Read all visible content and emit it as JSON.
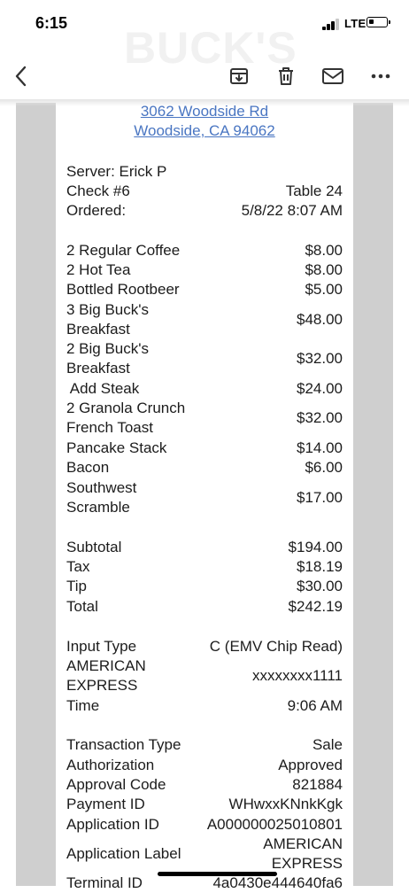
{
  "status_bar": {
    "time": "6:15",
    "network": "LTE"
  },
  "watermark": "BUCK'S",
  "toolbar": {
    "back_icon": "chevron-left-icon",
    "archive_icon": "archive-download-icon",
    "trash_icon": "trash-icon",
    "mail_icon": "envelope-icon",
    "more_icon": "more-horizontal-icon"
  },
  "receipt": {
    "address_line1": "3062 Woodside Rd",
    "address_line2": "Woodside, CA 94062",
    "server": "Server: Erick P",
    "check_label": "Check #6",
    "table_label": "Table 24",
    "ordered_label": "Ordered:",
    "ordered_value": "5/8/22 8:07 AM",
    "items": [
      {
        "name": "2 Regular Coffee",
        "price": "$8.00"
      },
      {
        "name": "2 Hot Tea",
        "price": "$8.00"
      },
      {
        "name": "Bottled Rootbeer",
        "price": "$5.00"
      },
      {
        "name": "3 Big Buck's",
        "name2": "Breakfast",
        "price": "$48.00"
      },
      {
        "name": "2 Big Buck's",
        "name2": "Breakfast",
        "price": "$32.00"
      },
      {
        "name": " Add Steak",
        "price": "$24.00"
      },
      {
        "name": "2 Granola Crunch",
        "name2": "French Toast",
        "price": "$32.00"
      },
      {
        "name": "Pancake Stack",
        "price": "$14.00"
      },
      {
        "name": "Bacon",
        "price": "$6.00"
      },
      {
        "name": "Southwest",
        "name2": "Scramble",
        "price": "$17.00"
      }
    ],
    "totals": [
      {
        "label": "Subtotal",
        "value": "$194.00"
      },
      {
        "label": "Tax",
        "value": "$18.19"
      },
      {
        "label": "Tip",
        "value": "$30.00"
      },
      {
        "label": "Total",
        "value": "$242.19"
      }
    ],
    "payment": {
      "input_type_label": "Input Type",
      "input_type_value": "C (EMV Chip Read)",
      "card_label_1": "AMERICAN",
      "card_label_2": "EXPRESS",
      "card_number": "xxxxxxxx1111",
      "time_label": "Time",
      "time_value": "9:06 AM"
    },
    "transaction": [
      {
        "label": "Transaction Type",
        "value": "Sale"
      },
      {
        "label": "Authorization",
        "value": "Approved"
      },
      {
        "label": "Approval Code",
        "value": "821884"
      },
      {
        "label": "Payment ID",
        "value": "WHwxxKNnkKgk"
      },
      {
        "label": "Application ID",
        "value": "A000000025010801"
      }
    ],
    "app_label": "Application Label",
    "app_label_value_1": "AMERICAN",
    "app_label_value_2": "EXPRESS",
    "terminal_label": "Terminal ID",
    "terminal_value": "4a0430e444640fa6"
  }
}
